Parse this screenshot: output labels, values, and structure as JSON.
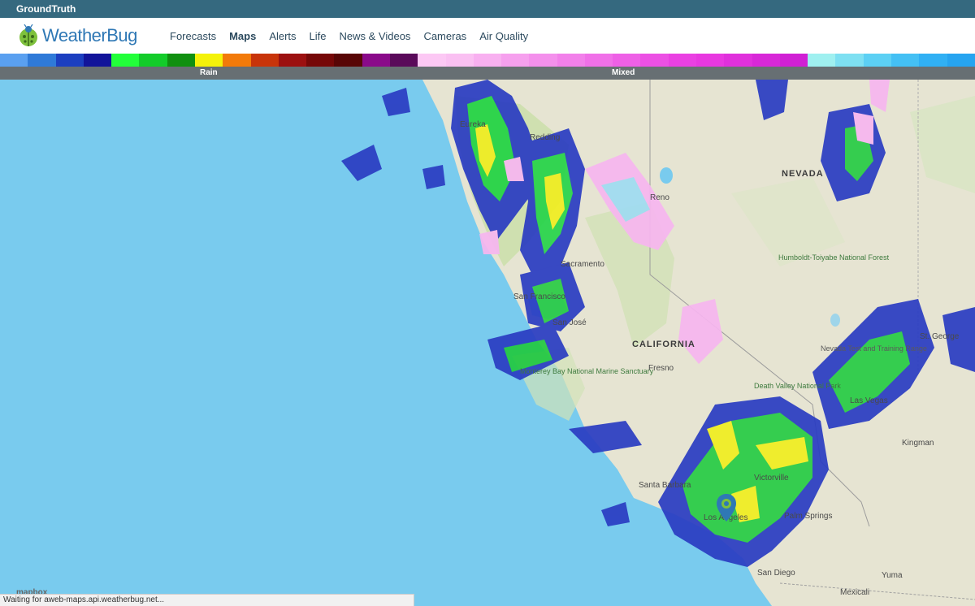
{
  "topbar": {
    "title": "GroundTruth"
  },
  "brand": {
    "name": "WeatherBug",
    "color": "#2f78b5",
    "icon": "ladybug-icon"
  },
  "nav": {
    "items": [
      {
        "label": "Forecasts",
        "active": false
      },
      {
        "label": "Maps",
        "active": true
      },
      {
        "label": "Alerts",
        "active": false
      },
      {
        "label": "Life",
        "active": false
      },
      {
        "label": "News & Videos",
        "active": false
      },
      {
        "label": "Cameras",
        "active": false
      },
      {
        "label": "Air Quality",
        "active": false
      }
    ]
  },
  "legend": {
    "rain_label": "Rain",
    "mixed_label": "Mixed",
    "colors": [
      "#5aa0f0",
      "#2f7ad8",
      "#1c3fc0",
      "#12149a",
      "#22ff3a",
      "#13cc2a",
      "#109010",
      "#f4f20a",
      "#f27a0a",
      "#c8340a",
      "#9c1010",
      "#760808",
      "#580606",
      "#8a0a8a",
      "#5a0a5a",
      "#fcc8f4",
      "#fac0f2",
      "#f8b0f0",
      "#f6a0ee",
      "#f490ec",
      "#f280ea",
      "#f070e8",
      "#ee60e6",
      "#ec50e4",
      "#ea40e2",
      "#e838e0",
      "#e030dc",
      "#d828d8",
      "#d020d4",
      "#9ff0f0",
      "#7ee0f2",
      "#5cd0f4",
      "#44c0f4",
      "#30b0f4",
      "#26a4f0"
    ]
  },
  "map": {
    "labels": {
      "nevada": "NEVADA",
      "california": "CALIFORNIA",
      "reno": "Reno",
      "sacramento": "Sacramento",
      "san_francisco": "San Francisco",
      "san_jose": "San José",
      "fresno": "Fresno",
      "redding": "Redding",
      "eureka": "Eureka",
      "los_angeles": "Los Angeles",
      "san_diego": "San Diego",
      "palm_springs": "Palm Springs",
      "victorville": "Victorville",
      "kingman": "Kingman",
      "las_vegas": "Las Vegas",
      "st_george": "St. George",
      "yuma": "Yuma",
      "mexicali": "Mexicali",
      "santa_barbara": "Santa Barbara",
      "humboldt": "Humboldt-Toiyabe National Forest",
      "monterey": "Monterey Bay National Marine Sanctuary",
      "death_valley": "Death Valley National Park",
      "nevada_test": "Nevada Test and Training Range",
      "mapbox": "mapbox"
    }
  },
  "status_bar": {
    "text": "Waiting for aweb-maps.api.weatherbug.net..."
  }
}
